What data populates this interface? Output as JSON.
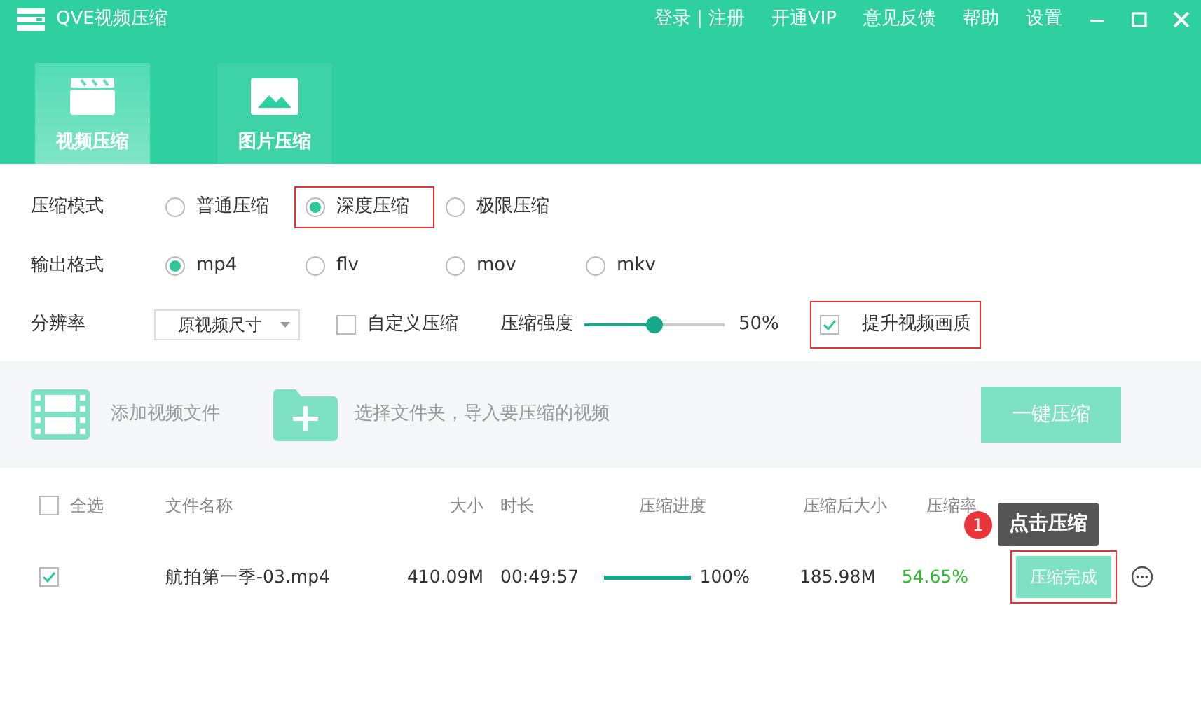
{
  "window": {
    "title": "QVE视频压缩",
    "links": [
      {
        "label": "登录"
      },
      {
        "label": "|",
        "kind": "separator"
      },
      {
        "label": "注册"
      },
      {
        "label": "开通VIP"
      },
      {
        "label": "意见反馈"
      },
      {
        "label": "帮助"
      },
      {
        "label": "设置"
      }
    ]
  },
  "tabs": [
    {
      "label": "视频压缩",
      "kind": "video",
      "selected": true
    },
    {
      "label": "图片压缩",
      "kind": "image",
      "selected": false
    }
  ],
  "mode": {
    "label": "压缩模式",
    "options": [
      {
        "label": "普通压缩",
        "selected": false,
        "highlighted": false
      },
      {
        "label": "深度压缩",
        "selected": true,
        "highlighted": true
      },
      {
        "label": "极限压缩",
        "selected": false,
        "highlighted": false
      }
    ]
  },
  "format": {
    "label": "输出格式",
    "options": [
      {
        "label": "mp4",
        "selected": true,
        "highlighted": false
      },
      {
        "label": "flv",
        "selected": false,
        "highlighted": false
      },
      {
        "label": "mov",
        "selected": false,
        "highlighted": false
      },
      {
        "label": "mkv",
        "selected": false,
        "highlighted": false
      }
    ]
  },
  "resolution": {
    "label": "分辨率",
    "value": "原视频尺寸"
  },
  "custom": {
    "label": "自定义压缩",
    "checked": false
  },
  "strength": {
    "label": "压缩强度",
    "level": 0.5,
    "reading": "50%"
  },
  "enhance": {
    "label": "提升视频画质",
    "checked": true,
    "highlighted": true
  },
  "toolbar": {
    "add_file": "添加视频文件",
    "add_folder": "选择文件夹，导入要压缩的视频",
    "compress": "一键压缩"
  },
  "table": {
    "select_all": {
      "label": "全选",
      "checked": false
    },
    "columns": [
      "文件名称",
      "大小",
      "时长",
      "压缩进度",
      "压缩后大小",
      "压缩率"
    ],
    "rows": [
      {
        "checked": true,
        "name": "航拍第一季-03.mp4",
        "size": "410.09M",
        "duration": "00:49:57",
        "progress": {
          "level": 1,
          "reading": "100%"
        },
        "compressed_size": "185.98M",
        "ratio": "54.65%",
        "action": {
          "label": "压缩完成",
          "highlighted": true
        }
      }
    ]
  },
  "tooltip": {
    "badge": "1",
    "text": "点击压缩"
  }
}
